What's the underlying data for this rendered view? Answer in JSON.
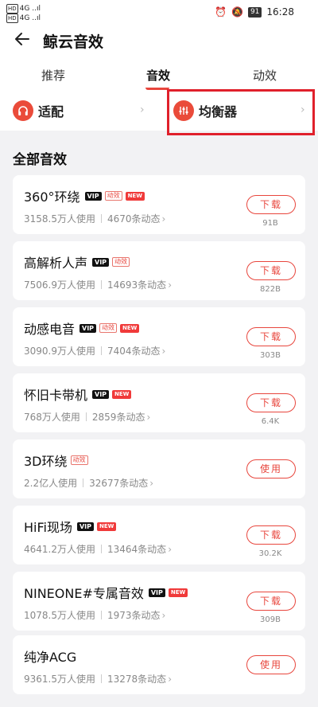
{
  "status": {
    "left_line1": "4G ..ıl",
    "left_line2": "4G ..ıl",
    "hd1": "HD",
    "hd2": "HD",
    "battery": "91",
    "time": "16:28"
  },
  "header": {
    "title": "鲸云音效"
  },
  "tabs": [
    {
      "label": "推荐"
    },
    {
      "label": "音效"
    },
    {
      "label": "动效"
    }
  ],
  "quick": [
    {
      "label": "适配"
    },
    {
      "label": "均衡器"
    }
  ],
  "section": {
    "title": "全部音效"
  },
  "effects": [
    {
      "name": "360°环绕",
      "users": "3158.5万人使用",
      "posts": "4670条动态",
      "action": "下载",
      "size": "91B",
      "vip": "VIP",
      "dong": "动效",
      "new": "NEW"
    },
    {
      "name": "高解析人声",
      "users": "7506.9万人使用",
      "posts": "14693条动态",
      "action": "下载",
      "size": "822B",
      "vip": "VIP",
      "dong": "动效",
      "new": ""
    },
    {
      "name": "动感电音",
      "users": "3090.9万人使用",
      "posts": "7404条动态",
      "action": "下载",
      "size": "303B",
      "vip": "VIP",
      "dong": "动效",
      "new": "NEW"
    },
    {
      "name": "怀旧卡带机",
      "users": "768万人使用",
      "posts": "2859条动态",
      "action": "下载",
      "size": "6.4K",
      "vip": "VIP",
      "dong": "",
      "new": "NEW"
    },
    {
      "name": "3D环绕",
      "users": "2.2亿人使用",
      "posts": "32677条动态",
      "action": "使用",
      "size": "",
      "vip": "",
      "dong": "动效",
      "new": ""
    },
    {
      "name": "HiFi现场",
      "users": "4641.2万人使用",
      "posts": "13464条动态",
      "action": "下载",
      "size": "30.2K",
      "vip": "VIP",
      "dong": "",
      "new": "NEW"
    },
    {
      "name": "NINEONE#专属音效",
      "users": "1078.5万人使用",
      "posts": "1973条动态",
      "action": "下载",
      "size": "309B",
      "vip": "VIP",
      "dong": "",
      "new": "NEW"
    },
    {
      "name": "纯净ACG",
      "users": "9361.5万人使用",
      "posts": "13278条动态",
      "action": "使用",
      "size": "",
      "vip": "",
      "dong": "",
      "new": ""
    }
  ],
  "colors": {
    "accent": "#e8463d",
    "highlight": "#e0202b",
    "background": "#f2f2f4"
  }
}
